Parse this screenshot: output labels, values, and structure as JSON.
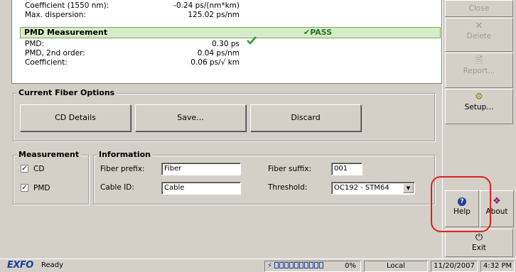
{
  "results": {
    "coef_label": "Coefficient (1550 nm):",
    "coef_value": "-0.24 ps/(nm*km)",
    "maxdisp_label": "Max. dispersion:",
    "maxdisp_value": "125.02 ps/nm",
    "pmd_header": "PMD Measurement",
    "pmd_status": "PASS",
    "pmd_label": "PMD:",
    "pmd_value": "0.30 ps",
    "pmd2_label": "PMD, 2nd order:",
    "pmd2_value": "0.04 ps/nm",
    "pmdcoef_label": "Coefficient:",
    "pmdcoef_value": "0.06 ps/√ km",
    "status_color": "#1f7a1f"
  },
  "current_fiber": {
    "title": "Current Fiber Options",
    "cd_details": "CD Details",
    "save": "Save...",
    "discard": "Discard"
  },
  "measurement": {
    "title": "Measurement",
    "cd_label": "CD",
    "cd_checked": true,
    "pmd_label": "PMD",
    "pmd_checked": true
  },
  "information": {
    "title": "Information",
    "fiber_prefix_label": "Fiber prefix:",
    "fiber_prefix_value": "Fiber",
    "cable_id_label": "Cable ID:",
    "cable_id_value": "Cable",
    "fiber_suffix_label": "Fiber suffix:",
    "fiber_suffix_value": "001",
    "threshold_label": "Threshold:",
    "threshold_value": "OC192 - STM64"
  },
  "sidebar": {
    "close": "Close",
    "delete": "Delete",
    "report": "Report...",
    "setup": "Setup...",
    "help": "Help",
    "about": "About",
    "exit": "Exit"
  },
  "statusbar": {
    "logo": "EXFO",
    "state": "Ready",
    "battery_percent": "0%",
    "time_mode": "Local",
    "date": "11/20/2007",
    "time": "4:32 PM"
  }
}
